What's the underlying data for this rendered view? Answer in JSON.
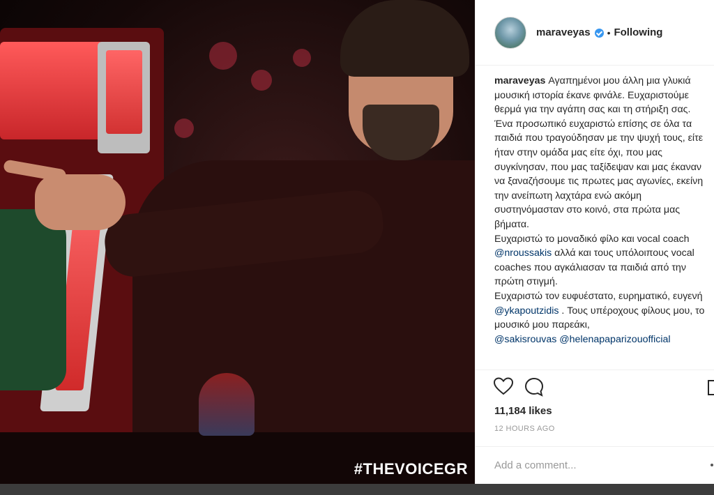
{
  "photo": {
    "hashtag": "#THEVOICEGR"
  },
  "header": {
    "username": "maraveyas",
    "separator": "•",
    "follow_label": "Following"
  },
  "caption": {
    "username": "maraveyas",
    "part1": " Αγαπημένοι μου άλλη μια γλυκιά μουσική ιστορία έκανε φινάλε. Ευχαριστούμε θερμά για την αγάπη σας και τη στήριξη σας. Ένα προσωπικό ευχαριστώ επίσης σε όλα τα παιδιά που τραγούδησαν με την ψυχή τους, είτε ήταν στην ομάδα μας είτε όχι, που μας συγκίνησαν, που μας ταξίδεψαν και μας έκαναν να ξαναζήσουμε τις πρωτες μας αγωνίες, εκείνη την ανείπωτη λαχτάρα ενώ ακόμη συστηνόμασταν στο κοινό, στα πρώτα μας βήματα.",
    "part2_pre": "Ευχαριστώ το μοναδικό φίλο και vocal coach ",
    "mention1": "@nroussakis",
    "part2_post": " αλλά και τους υπόλοιπους vocal coaches που αγκάλιασαν τα παιδιά από την πρώτη στιγμή.",
    "part3_pre": "Ευχαριστώ τον ευφυέστατο, ευρηματικό, ευγενή ",
    "mention2": "@ykapoutzidis",
    "part3_post": " . Τους υπέροχους φίλους μου, το μουσικό μου παρεάκι,",
    "mention3": "@sakisrouvas",
    "mention4": "@helenapaparizouofficial"
  },
  "actions": {
    "likes": "11,184 likes",
    "time": "12 HOURS AGO"
  },
  "comment": {
    "placeholder": "Add a comment..."
  },
  "colors": {
    "link": "#003569",
    "verified": "#3897f0"
  }
}
